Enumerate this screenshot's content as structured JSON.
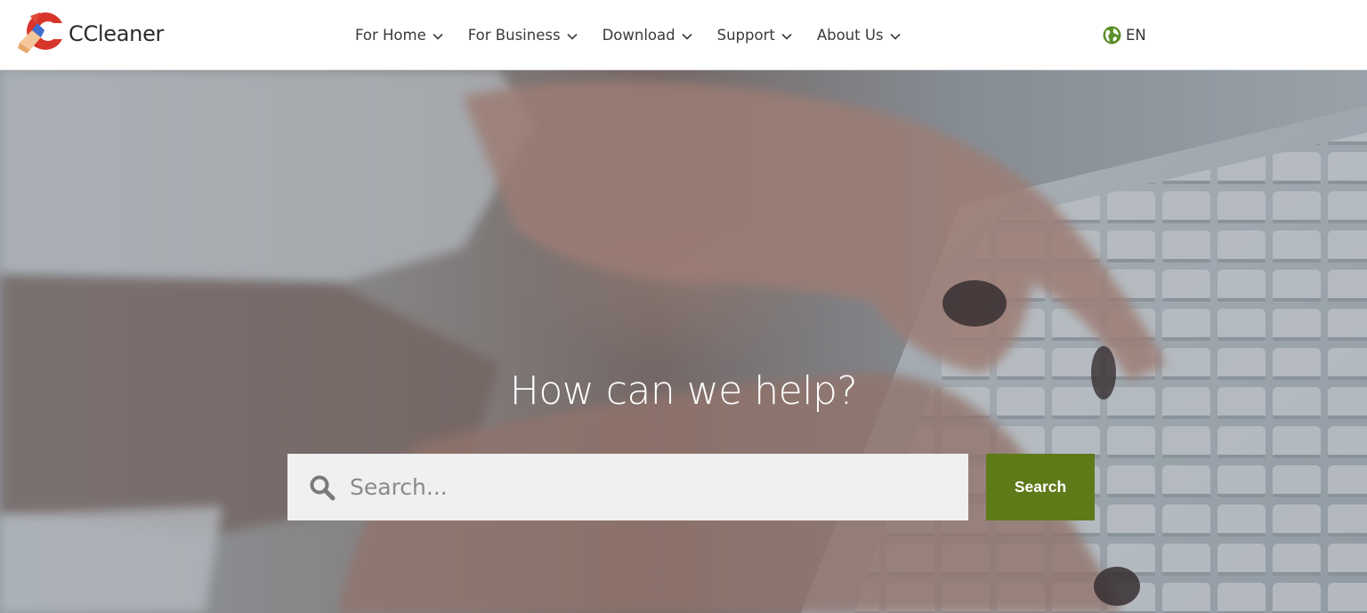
{
  "header": {
    "brand": "CCleaner",
    "nav": [
      {
        "label": "For Home"
      },
      {
        "label": "For Business"
      },
      {
        "label": "Download"
      },
      {
        "label": "Support"
      },
      {
        "label": "About Us"
      }
    ],
    "language": "EN"
  },
  "hero": {
    "title": "How can we help?",
    "search": {
      "placeholder": "Search...",
      "value": "",
      "button_label": "Search"
    }
  },
  "colors": {
    "accent": "#5f7a19",
    "logo_red": "#d8352a",
    "globe_green": "#5c8f2a"
  },
  "icons": [
    "ccleaner-logo-icon",
    "chevron-down-icon",
    "globe-icon",
    "search-icon"
  ]
}
